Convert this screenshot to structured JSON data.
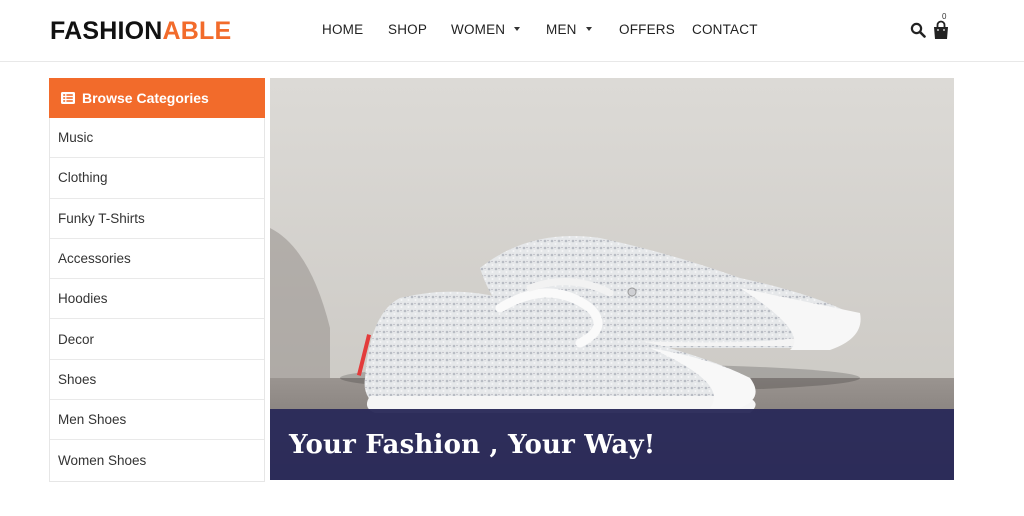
{
  "brand": {
    "part1": "FASHION",
    "part2": "ABLE",
    "accent_color": "#f26b2b"
  },
  "nav": {
    "home": "HOME",
    "shop": "SHOP",
    "women": "WOMEN",
    "men": "MEN",
    "offers": "OFFERS",
    "contact": "CONTACT"
  },
  "header_icons": {
    "search": "search-icon",
    "cart": "shopping-bag-icon",
    "cart_count": "0"
  },
  "sidebar": {
    "title": "Browse Categories",
    "icon": "list-icon",
    "items": [
      {
        "label": "Music"
      },
      {
        "label": "Clothing"
      },
      {
        "label": "Funky T-Shirts"
      },
      {
        "label": "Accessories"
      },
      {
        "label": "Hoodies"
      },
      {
        "label": "Decor"
      },
      {
        "label": "Shoes"
      },
      {
        "label": "Men Shoes"
      },
      {
        "label": "Women Shoes"
      }
    ]
  },
  "hero": {
    "title": "Your Fashion , Your Way!",
    "bar_color": "#2a2a58"
  }
}
